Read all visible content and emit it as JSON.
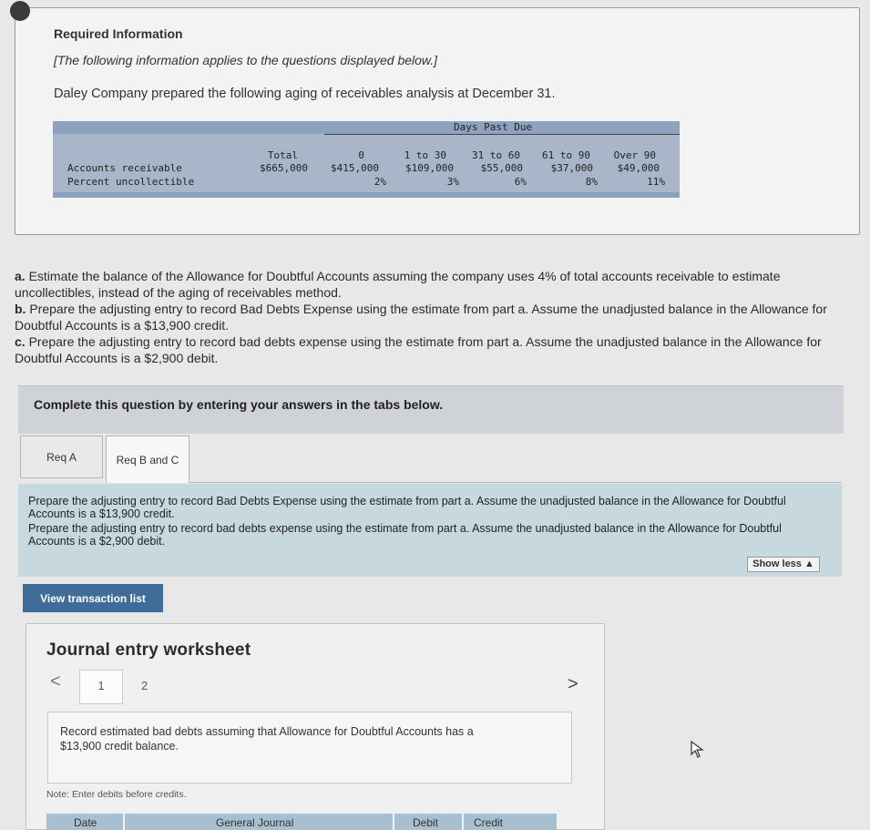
{
  "info": {
    "title": "Required Information",
    "subtitle": "[The following information applies to the questions displayed below.]",
    "intro": "Daley Company prepared the following aging of receivables analysis at December 31."
  },
  "aging": {
    "header_group": "Days Past Due",
    "columns": [
      "Total",
      "0",
      "1 to 30",
      "31 to 60",
      "61 to 90",
      "Over 90"
    ],
    "rows": [
      {
        "label": "Accounts receivable",
        "values": [
          "$665,000",
          "$415,000",
          "$109,000",
          "$55,000",
          "$37,000",
          "$49,000"
        ]
      },
      {
        "label": "Percent uncollectible",
        "values": [
          "",
          "2%",
          "3%",
          "6%",
          "8%",
          "11%"
        ]
      }
    ]
  },
  "questions": {
    "a_label": "a.",
    "a_text": " Estimate the balance of the Allowance for Doubtful Accounts assuming the company uses 4% of total accounts receivable to estimate uncollectibles, instead of the aging of receivables method.",
    "b_label": "b.",
    "b_text": " Prepare the adjusting entry to record Bad Debts Expense using the estimate from part a. Assume the unadjusted balance in the Allowance for Doubtful Accounts is a $13,900 credit.",
    "c_label": "c.",
    "c_text": " Prepare the adjusting entry to record bad debts expense using the estimate from part a. Assume the unadjusted balance in the Allowance for Doubtful Accounts is a $2,900 debit."
  },
  "complete_bar": "Complete this question by entering your answers in the tabs below.",
  "tabs": [
    {
      "label": "Req A"
    },
    {
      "label": "Req B and C"
    }
  ],
  "req_panel": {
    "line1": "Prepare the adjusting entry to record Bad Debts Expense using the estimate from part a. Assume the unadjusted balance in the Allowance for Doubtful Accounts is a $13,900 credit.",
    "line2": "Prepare the adjusting entry to record bad debts expense using the estimate from part a. Assume the unadjusted balance in the Allowance for Doubtful Accounts is a $2,900 debit.",
    "show_less": "Show less ▲"
  },
  "view_transaction_list": "View transaction list",
  "worksheet": {
    "title": "Journal entry worksheet",
    "prev": "<",
    "next": ">",
    "pages": [
      "1",
      "2"
    ],
    "instruction": "Record estimated bad debts assuming that Allowance for Doubtful Accounts has a $13,900 credit balance.",
    "note": "Note: Enter debits before credits.",
    "columns": [
      "Date",
      "General Journal",
      "Debit",
      "Credit"
    ]
  }
}
